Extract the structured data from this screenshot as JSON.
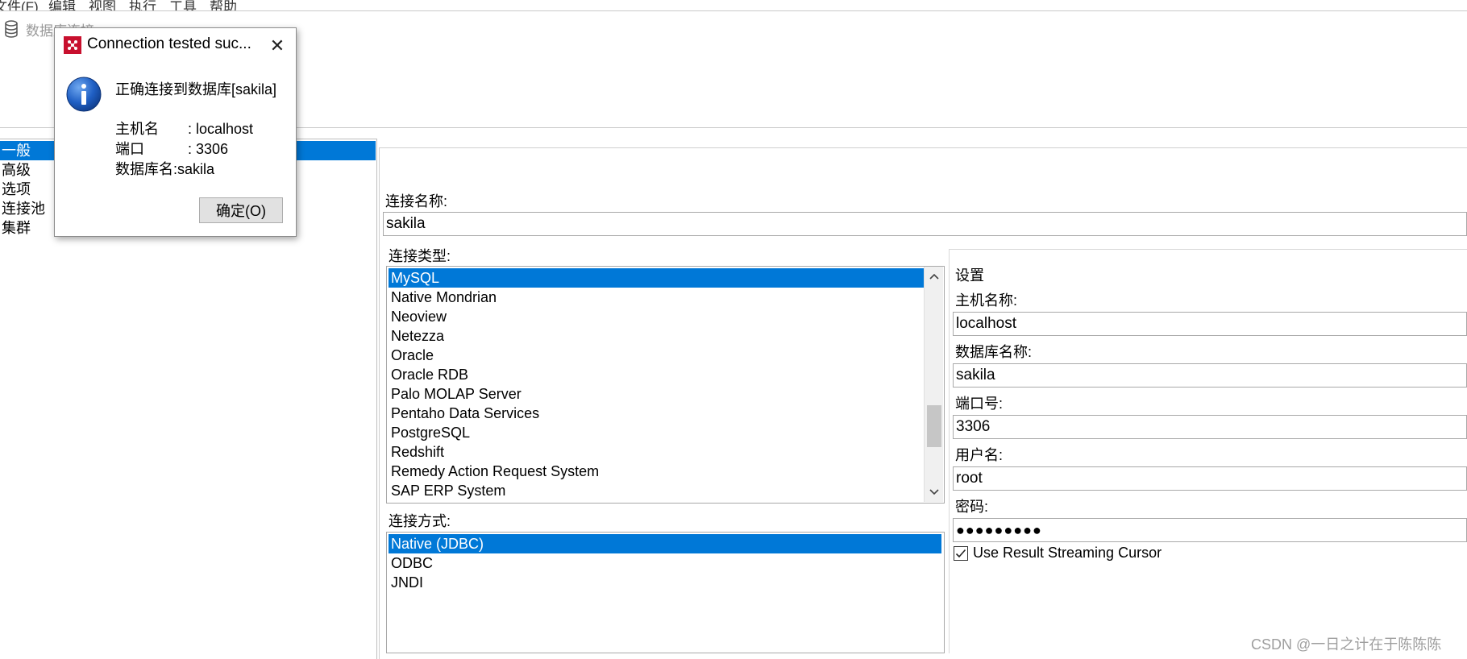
{
  "menu": {
    "items": [
      "文件(F)",
      "编辑",
      "视图",
      "执行",
      "工具",
      "帮助"
    ]
  },
  "header": {
    "title": "数据库连接",
    "icon": "database-icon"
  },
  "left_nav": {
    "items": [
      {
        "label": "一般",
        "selected": true
      },
      {
        "label": "高级",
        "selected": false
      },
      {
        "label": "选项",
        "selected": false
      },
      {
        "label": "连接池",
        "selected": false
      },
      {
        "label": "集群",
        "selected": false
      }
    ]
  },
  "form": {
    "connection_name_label": "连接名称:",
    "connection_name_value": "sakila",
    "connection_type_label": "连接类型:",
    "connection_types": [
      "MySQL",
      "Native Mondrian",
      "Neoview",
      "Netezza",
      "Oracle",
      "Oracle RDB",
      "Palo MOLAP Server",
      "Pentaho Data Services",
      "PostgreSQL",
      "Redshift",
      "Remedy Action Request System",
      "SAP ERP System"
    ],
    "selected_connection_type": "MySQL",
    "access_method_label": "连接方式:",
    "access_methods": [
      "Native (JDBC)",
      "ODBC",
      "JNDI"
    ],
    "selected_access_method": "Native (JDBC)"
  },
  "settings": {
    "title": "设置",
    "host_label": "主机名称:",
    "host_value": "localhost",
    "db_name_label": "数据库名称:",
    "db_name_value": "sakila",
    "port_label": "端口号:",
    "port_value": "3306",
    "user_label": "用户名:",
    "user_value": "root",
    "password_label": "密码:",
    "password_value": "●●●●●●●●●",
    "streaming_cursor_label": "Use Result Streaming Cursor",
    "streaming_cursor_checked": true
  },
  "dialog": {
    "title": "Connection tested suc...",
    "message": "正确连接到数据库[sakila]",
    "host_line": "主机名　　: localhost",
    "port_line": "端口　　　: 3306",
    "db_line": "数据库名:sakila",
    "ok_label": "确定(O)",
    "close_glyph": "✕"
  },
  "colors": {
    "selection": "#0078d7",
    "brand_icon": "#c8102e"
  },
  "watermark": "CSDN @一日之计在于陈陈陈"
}
